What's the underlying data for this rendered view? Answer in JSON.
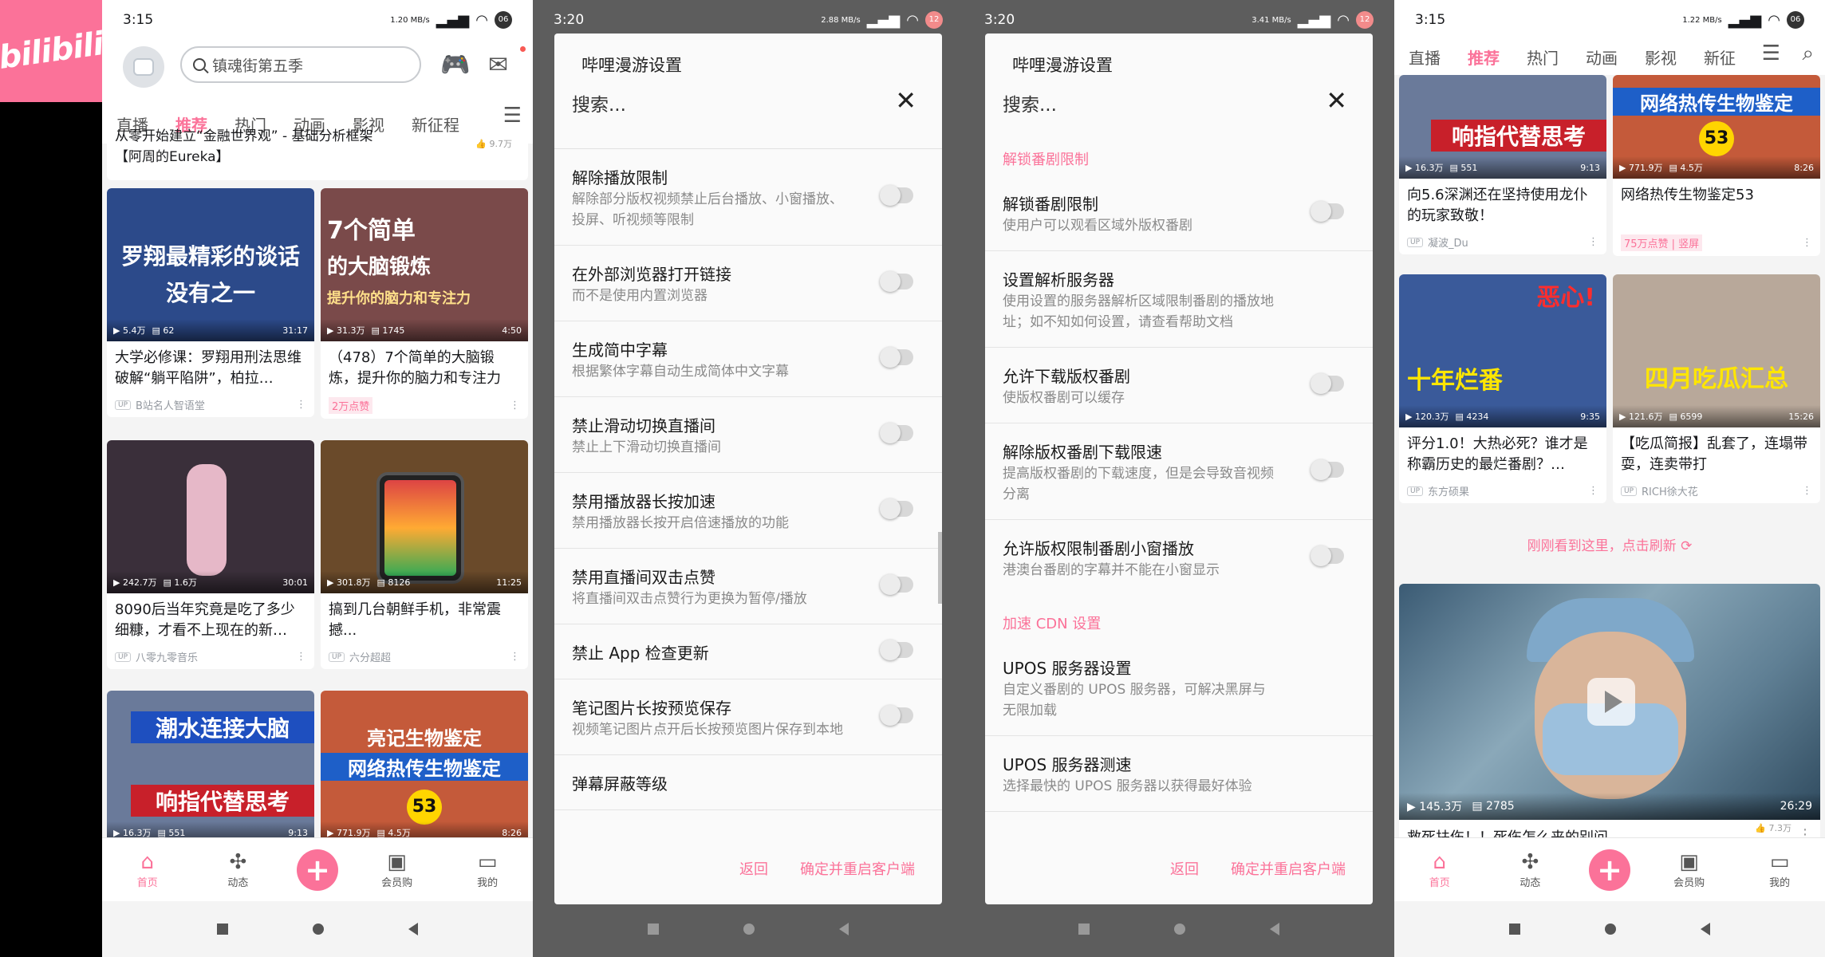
{
  "logo": {
    "text": "bilibili"
  },
  "phone1": {
    "status": {
      "time": "3:15",
      "speed": "1.20 MB/s",
      "badge": "06"
    },
    "search": {
      "placeholder": "镇魂街第五季"
    },
    "tabs": [
      "直播",
      "推荐",
      "热门",
      "动画",
      "影视",
      "新征程"
    ],
    "top_strip": {
      "line1": "从零开始建立“金融世界观” - 基础分析框架",
      "line2": "【阿周的Eureka】",
      "likes": "9.7万"
    },
    "cards": [
      {
        "thumb_text1": "罗翔最精彩的谈话",
        "thumb_text2": "没有之一",
        "views": "5.4万",
        "danmaku": "62",
        "duration": "31:17",
        "title": "大学必修课：罗翔用刑法思维破解“躺平陷阱”，柏拉…",
        "author": "B站名人智语堂",
        "bg": "#2c4a8a"
      },
      {
        "thumb_text1": "7个简单",
        "thumb_text2": "的大脑锻炼",
        "thumb_text3": "提升你的脑力和专注力",
        "views": "31.3万",
        "danmaku": "1745",
        "duration": "4:50",
        "title": "（478）7个简单的大脑锻炼，提升你的脑力和专注力",
        "author": "",
        "pink_tag": "2万点赞",
        "bg": "#7a4a4a"
      },
      {
        "views": "242.7万",
        "danmaku": "1.6万",
        "duration": "30:01",
        "title": "8090后当年究竟是吃了多少细糠，才看不上现在的新…",
        "author": "八零九零音乐",
        "bg": "#3a2f3a"
      },
      {
        "views": "301.8万",
        "danmaku": "8126",
        "duration": "11:25",
        "title": "搞到几台朝鲜手机，非常震撼...",
        "author": "六分超超",
        "bg": "#6a4a2a"
      },
      {
        "thumb_text1": "潮水连接大脑",
        "thumb_text2": "响指代替思考",
        "views": "16.3万",
        "danmaku": "551",
        "duration": "9:13",
        "title": "",
        "author": "",
        "bg": "#6a7a9a"
      },
      {
        "thumb_text1": "亮记生物鉴定",
        "thumb_text2": "网络热传生物鉴定",
        "thumb_text3": "53",
        "views": "771.9万",
        "danmaku": "4.5万",
        "duration": "8:26",
        "title": "",
        "author": "",
        "bg": "#c45a3a"
      }
    ],
    "nav": [
      "首页",
      "动态",
      "+",
      "会员购",
      "我的"
    ]
  },
  "phone2": {
    "status": {
      "time": "3:20",
      "speed": "2.88 MB/s",
      "badge": "12"
    },
    "dialog": {
      "title": "哔哩漫游设置",
      "search": "搜索...",
      "rows": [
        {
          "title": "解除播放限制",
          "sub": "解除部分版权视频禁止后台播放、小窗播放、投屏、听视频等限制"
        },
        {
          "title": "在外部浏览器打开链接",
          "sub": "而不是使用内置浏览器"
        },
        {
          "title": "生成简中字幕",
          "sub": "根据繁体字幕自动生成简体中文字幕"
        },
        {
          "title": "禁止滑动切换直播间",
          "sub": "禁止上下滑动切换直播间"
        },
        {
          "title": "禁用播放器长按加速",
          "sub": "禁用播放器长按开启倍速播放的功能"
        },
        {
          "title": "禁用直播间双击点赞",
          "sub": "将直播间双击点赞行为更换为暂停/播放"
        },
        {
          "title": "禁止 App 检查更新",
          "sub": ""
        },
        {
          "title": "笔记图片长按预览保存",
          "sub": "视频笔记图片点开后长按预览图片保存到本地"
        },
        {
          "title": "弹幕屏蔽等级",
          "sub": ""
        }
      ],
      "back": "返回",
      "confirm": "确定并重启客户端"
    }
  },
  "phone3": {
    "status": {
      "time": "3:20",
      "speed": "3.41 MB/s",
      "badge": "12"
    },
    "dialog": {
      "title": "哔哩漫游设置",
      "search": "搜索...",
      "section1": "解锁番剧限制",
      "rows1": [
        {
          "title": "解锁番剧限制",
          "sub": "使用户可以观看区域外版权番剧",
          "toggle": true
        },
        {
          "title": "设置解析服务器",
          "sub": "使用设置的服务器解析区域限制番剧的播放地址；如不知如何设置，请查看帮助文档",
          "toggle": false
        },
        {
          "title": "允许下载版权番剧",
          "sub": "使版权番剧可以缓存",
          "toggle": true
        },
        {
          "title": "解除版权番剧下载限速",
          "sub": "提高版权番剧的下载速度，但是会导致音视频分离",
          "toggle": true
        },
        {
          "title": "允许版权限制番剧小窗播放",
          "sub": "港澳台番剧的字幕并不能在小窗显示",
          "toggle": true
        }
      ],
      "section2": "加速 CDN 设置",
      "rows2": [
        {
          "title": "UPOS 服务器设置",
          "sub": "自定义番剧的 UPOS 服务器，可解决黑屏与无限加载"
        },
        {
          "title": "UPOS 服务器测速",
          "sub": "选择最快的 UPOS 服务器以获得最好体验"
        }
      ],
      "back": "返回",
      "confirm": "确定并重启客户端"
    }
  },
  "phone4": {
    "status": {
      "time": "3:15",
      "speed": "1.22 MB/s",
      "badge": "06"
    },
    "tabs": [
      "直播",
      "推荐",
      "热门",
      "动画",
      "影视",
      "新征"
    ],
    "cards": [
      {
        "thumb_text1": "响指代替思考",
        "views": "16.3万",
        "danmaku": "551",
        "duration": "9:13",
        "title": "向5.6深渊还在坚持使用龙仆的玩家致敬！",
        "author": "凝波_Du",
        "bg": "#6a7a9a"
      },
      {
        "thumb_text1": "网络热传生物鉴定",
        "thumb_text3": "53",
        "views": "771.9万",
        "danmaku": "4.5万",
        "duration": "8:26",
        "title": "网络热传生物鉴定53",
        "pink_tag": "75万点赞 | 竖屏",
        "author": "",
        "bg": "#c45a3a"
      },
      {
        "thumb_text1": "恶心!",
        "thumb_text2": "十年烂番",
        "views": "120.3万",
        "danmaku": "4234",
        "duration": "9:35",
        "title": "评分1.0！大热必死？谁才是称霸历史的最烂番剧？…",
        "author": "东方硕果",
        "bg": "#3a5a9a"
      },
      {
        "thumb_text1": "四月吃瓜汇总",
        "views": "121.6万",
        "danmaku": "6599",
        "duration": "15:26",
        "title": "【吃瓜简报】乱套了，连塌带耍，连卖带打",
        "author": "RICH徐大花",
        "bg": "#b8a89a"
      }
    ],
    "refresh": "刚刚看到这里，点击刷新",
    "big_video": {
      "views": "145.3万",
      "danmaku": "2785",
      "duration": "26:29",
      "title": "救死扶伤！！死伤怎么来的别问",
      "likes": "7.3万"
    },
    "nav": [
      "首页",
      "动态",
      "+",
      "会员购",
      "我的"
    ]
  }
}
